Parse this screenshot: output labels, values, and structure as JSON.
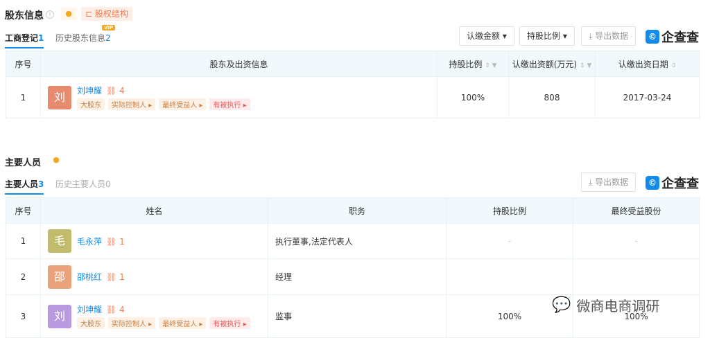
{
  "shareholders": {
    "title": "股东信息",
    "info_icon": "i",
    "equity_label": "股权结构",
    "tabs": [
      {
        "label": "工商登记",
        "count": "1"
      },
      {
        "label": "历史股东信息",
        "count": "2",
        "badge": "VIP"
      }
    ],
    "buttons": {
      "amount": "认缴金额 ▾",
      "ratio": "持股比例 ▾",
      "export": "导出数据"
    },
    "logo": "企查查",
    "headers": [
      "序号",
      "股东及出资信息",
      "持股比例",
      "认缴出资额(万元)",
      "认缴出资日期"
    ],
    "rows": [
      {
        "index": "1",
        "avatar": "刘",
        "name": "刘坤耀",
        "count": "4",
        "tags": [
          "大股东",
          "实际控制人 ▸",
          "最终受益人 ▸",
          "有被执行 ▸"
        ],
        "ratio": "100%",
        "amount": "808",
        "date": "2017-03-24"
      }
    ]
  },
  "personnel": {
    "title": "主要人员",
    "tabs": [
      {
        "label": "主要人员",
        "count": "3"
      },
      {
        "label": "历史主要人员",
        "count": "0"
      }
    ],
    "export": "导出数据",
    "logo": "企查查",
    "headers": [
      "序号",
      "姓名",
      "职务",
      "持股比例",
      "最终受益股份"
    ],
    "rows": [
      {
        "index": "1",
        "avatar": "毛",
        "color": "#c1bb6b",
        "name": "毛永萍",
        "count": "1",
        "tags": [],
        "position": "执行董事,法定代表人",
        "ratio": "-",
        "benefit": "-"
      },
      {
        "index": "2",
        "avatar": "邵",
        "color": "#e9a27a",
        "name": "邵桃红",
        "count": "1",
        "tags": [],
        "position": "经理",
        "ratio": "",
        "benefit": ""
      },
      {
        "index": "3",
        "avatar": "刘",
        "color": "#b99ae0",
        "name": "刘坤耀",
        "count": "4",
        "tags": [
          "大股东",
          "实际控制人 ▸",
          "最终受益人 ▸",
          "有被执行 ▸"
        ],
        "position": "监事",
        "ratio": "100%",
        "benefit": "100%"
      }
    ]
  },
  "watermark": "微商电商调研"
}
